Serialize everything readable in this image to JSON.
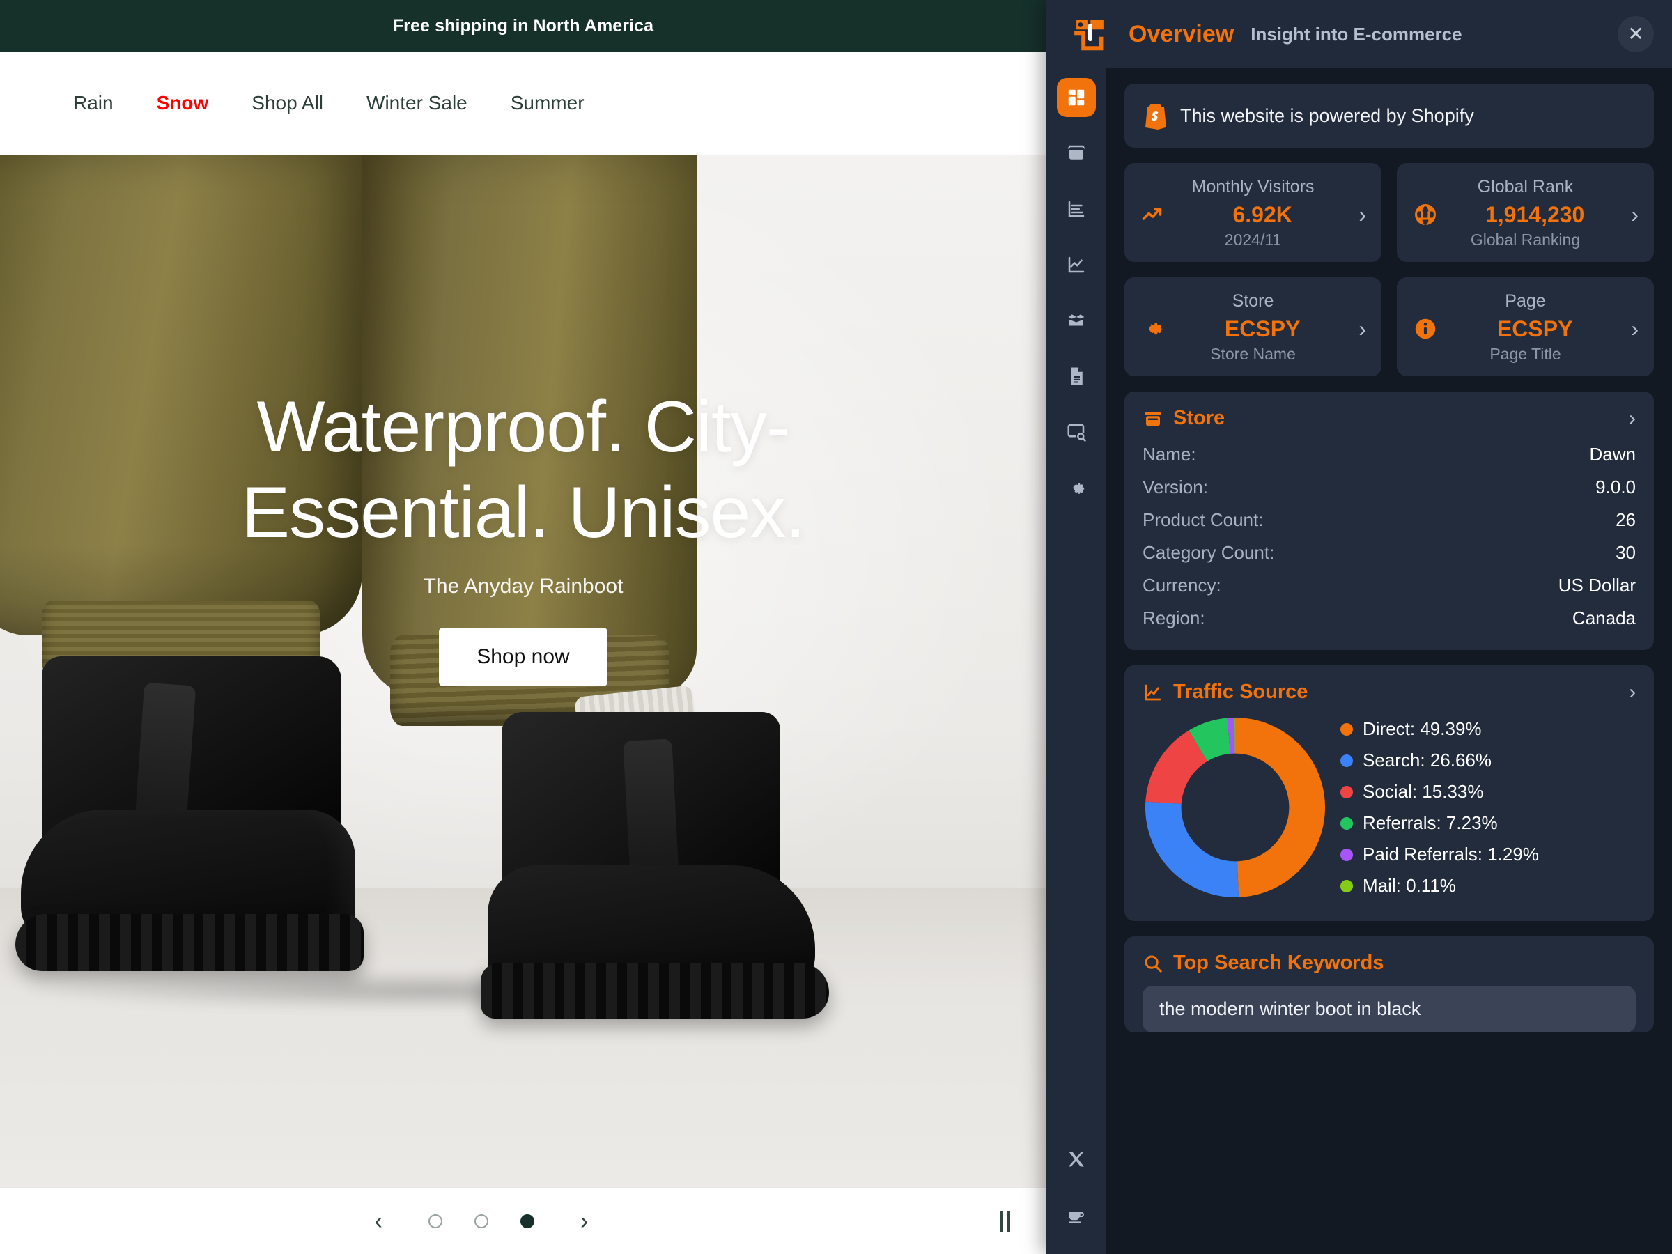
{
  "site": {
    "announcement": "Free shipping in North America",
    "nav": [
      {
        "label": "Rain",
        "active": false
      },
      {
        "label": "Snow",
        "active": true
      },
      {
        "label": "Shop All",
        "active": false
      },
      {
        "label": "Winter Sale",
        "active": false
      },
      {
        "label": "Summer",
        "active": false
      }
    ],
    "hero": {
      "headline_line1": "Waterproof. City-",
      "headline_line2": "Essential. Unisex.",
      "subtitle": "The Anyday Rainboot",
      "cta": "Shop now"
    },
    "carousel": {
      "prev": "‹",
      "next": "›",
      "slide_count": 3,
      "active_slide": 3,
      "pause_label": "Pause"
    }
  },
  "panel": {
    "header": {
      "title": "Overview",
      "subtitle": "Insight into E-commerce",
      "close": "✕"
    },
    "rail": {
      "items": [
        {
          "name": "dashboard",
          "active": true
        },
        {
          "name": "store",
          "active": false
        },
        {
          "name": "bar-chart",
          "active": false
        },
        {
          "name": "line-chart",
          "active": false
        },
        {
          "name": "package",
          "active": false
        },
        {
          "name": "document",
          "active": false
        },
        {
          "name": "page-search",
          "active": false
        },
        {
          "name": "settings",
          "active": false
        }
      ],
      "bottom": [
        {
          "name": "x-twitter"
        },
        {
          "name": "coffee"
        }
      ]
    },
    "powered_by": "This website is powered by Shopify",
    "stats": [
      {
        "label": "Monthly Visitors",
        "value": "6.92K",
        "note": "2024/11",
        "icon": "trend-up-icon",
        "chevron": "›"
      },
      {
        "label": "Global Rank",
        "value": "1,914,230",
        "note": "Global Ranking",
        "icon": "globe-icon",
        "chevron": "›"
      },
      {
        "label": "Store",
        "value": "ECSPY",
        "note": "Store Name",
        "icon": "gear-icon",
        "chevron": "›"
      },
      {
        "label": "Page",
        "value": "ECSPY",
        "note": "Page Title",
        "icon": "info-icon",
        "chevron": "›"
      }
    ],
    "store_section": {
      "title": "Store",
      "chevron": "›",
      "rows": [
        {
          "key": "Name:",
          "value": "Dawn"
        },
        {
          "key": "Version:",
          "value": "9.0.0"
        },
        {
          "key": "Product Count:",
          "value": "26"
        },
        {
          "key": "Category Count:",
          "value": "30"
        },
        {
          "key": "Currency:",
          "value": "US Dollar"
        },
        {
          "key": "Region:",
          "value": "Canada"
        }
      ]
    },
    "traffic_section": {
      "title": "Traffic Source",
      "chevron": "›"
    },
    "keywords_section": {
      "title": "Top Search Keywords",
      "items": [
        "the modern winter boot in black"
      ]
    }
  },
  "chart_data": {
    "type": "pie",
    "title": "Traffic Source",
    "variant": "donut",
    "legend_position": "right",
    "categories": [
      "Direct",
      "Search",
      "Social",
      "Referrals",
      "Paid Referrals",
      "Mail"
    ],
    "values": [
      49.39,
      26.66,
      15.33,
      7.23,
      1.29,
      0.11
    ],
    "unit": "%",
    "labels": [
      "Direct: 49.39%",
      "Search: 26.66%",
      "Social: 15.33%",
      "Referrals: 7.23%",
      "Paid Referrals: 1.29%",
      "Mail: 0.11%"
    ],
    "colors": [
      "#f2720c",
      "#3b82f6",
      "#ef4444",
      "#22c55e",
      "#a855f7",
      "#84cc16"
    ],
    "start_angle": -90,
    "inner_radius_ratio": 0.6
  },
  "colors": {
    "accent": "#f2720c",
    "panel_bg": "#131923",
    "card_bg": "#222c3c",
    "rail_bg": "#202a3a",
    "site_banner": "#16302a",
    "nav_active": "#ff0000"
  }
}
